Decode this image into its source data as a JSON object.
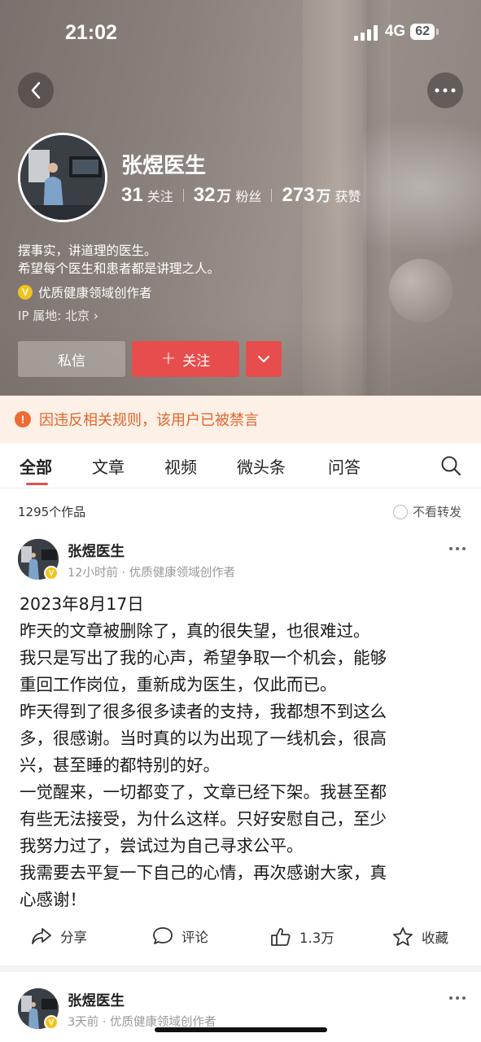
{
  "status_bar": {
    "time": "21:02",
    "network": "4G",
    "battery": "62"
  },
  "profile": {
    "name": "张煜医生",
    "stats": [
      {
        "num": "31",
        "unit": "",
        "label": "关注"
      },
      {
        "num": "32",
        "unit": "万",
        "label": "粉丝"
      },
      {
        "num": "273",
        "unit": "万",
        "label": "获赞"
      }
    ],
    "bio_line1": "摆事实，讲道理的医生。",
    "bio_line2": "希望每个医生和患者都是讲理之人。",
    "creator_badge": "V",
    "creator_label": "优质健康领域创作者",
    "ip": "IP 属地: 北京 ›",
    "message_button": "私信",
    "follow_button": "关注",
    "follow_icon": "+"
  },
  "notice": {
    "icon": "!",
    "text": "因违反相关规则，该用户已被禁言"
  },
  "tabs": [
    "全部",
    "文章",
    "视频",
    "微头条",
    "问答"
  ],
  "works": {
    "count": "1295个作品",
    "filter_label": "不看转发"
  },
  "post": {
    "author": "张煜医生",
    "meta": "12小时前 · 优质健康领域创作者",
    "body": "2023年8月17日\n昨天的文章被删除了，真的很失望，也很难过。\n我只是写出了我的心声，希望争取一个机会，能够\n重回工作岗位，重新成为医生，仅此而已。\n昨天得到了很多很多读者的支持，我都想不到这么\n多，很感谢。当时真的以为出现了一线机会，很高\n兴，甚至睡的都特别的好。\n一觉醒来，一切都变了，文章已经下架。我甚至都\n有些无法接受，为什么这样。只好安慰自己，至少\n我努力过了，尝试过为自己寻求公平。\n我需要去平复一下自己的心情，再次感谢大家，真\n心感谢！",
    "actions": {
      "share": "分享",
      "comment": "评论",
      "like": "1.3万",
      "favorite": "收藏"
    }
  },
  "post2": {
    "author": "张煜医生",
    "meta": "3天前 · 优质健康领域创作者"
  },
  "colors": {
    "accent": "#e84d4d",
    "notice_text": "#e5642c",
    "notice_bg": "#fdf0e6",
    "badge": "#f2c31b"
  },
  "icons": [
    "back-icon",
    "more-icon",
    "chevron-down-icon",
    "search-icon",
    "share-icon",
    "comment-icon",
    "like-icon",
    "favorite-icon"
  ]
}
